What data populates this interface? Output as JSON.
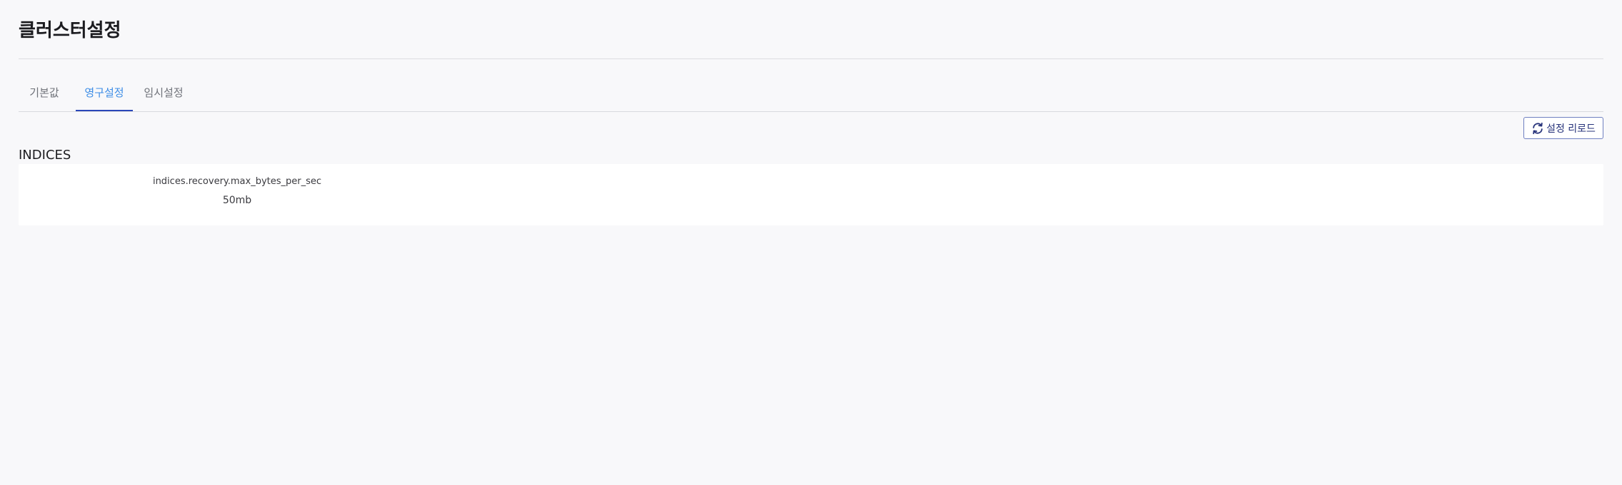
{
  "page": {
    "title": "클러스터설정"
  },
  "tabs": [
    {
      "label": "기본값",
      "active": false
    },
    {
      "label": "영구설정",
      "active": true
    },
    {
      "label": "임시설정",
      "active": false
    }
  ],
  "toolbar": {
    "reload_label": "설정 리로드",
    "reload_icon": "refresh-icon"
  },
  "section": {
    "title": "INDICES",
    "settings": [
      {
        "key": "indices.recovery.max_bytes_per_sec",
        "value": "50mb"
      }
    ]
  },
  "colors": {
    "accent": "#3d8de6",
    "tab_indicator": "#2a47b8",
    "button_border": "#6f7fc0",
    "background": "#f8f8fa"
  }
}
